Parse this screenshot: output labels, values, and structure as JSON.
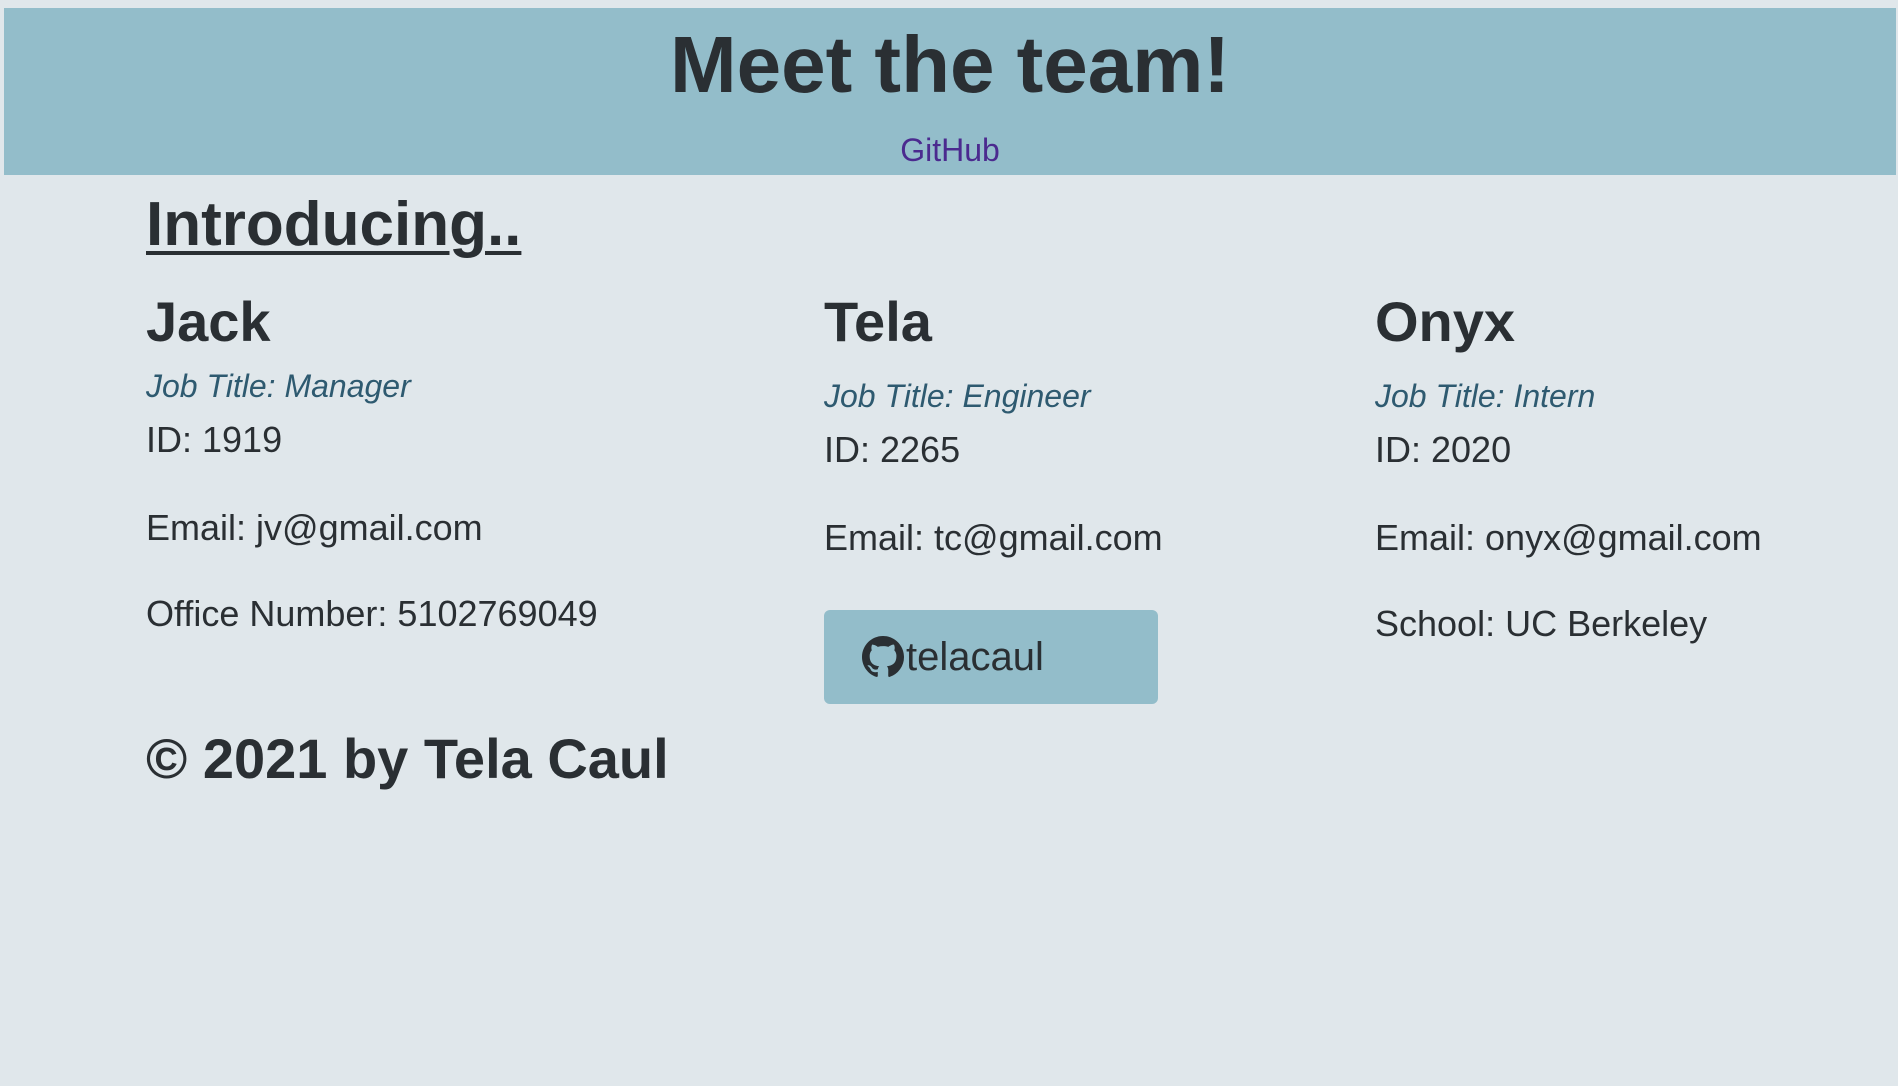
{
  "header": {
    "title": "Meet the team!",
    "link_label": "GitHub"
  },
  "intro": {
    "heading": "Introducing.."
  },
  "team": [
    {
      "name": "Jack",
      "role": "Job Title: Manager",
      "id": "ID: 1919",
      "email": "Email: jv@gmail.com",
      "extra": "Office Number: 5102769049"
    },
    {
      "name": "Tela",
      "role": "Job Title: Engineer",
      "id": "ID: 2265",
      "email": "Email: tc@gmail.com",
      "github": "telacaul"
    },
    {
      "name": "Onyx",
      "role": "Job Title: Intern",
      "id": "ID: 2020",
      "email": "Email: onyx@gmail.com",
      "extra": "School: UC Berkeley"
    }
  ],
  "footer": {
    "copyright": "© 2021 by Tela Caul"
  },
  "colors": {
    "header_bg": "#93bdca",
    "page_bg": "#e0e7eb",
    "text": "#2a2f33",
    "link": "#4b2a8f",
    "role": "#2e5a70"
  },
  "icons": {
    "github": "github-icon"
  }
}
